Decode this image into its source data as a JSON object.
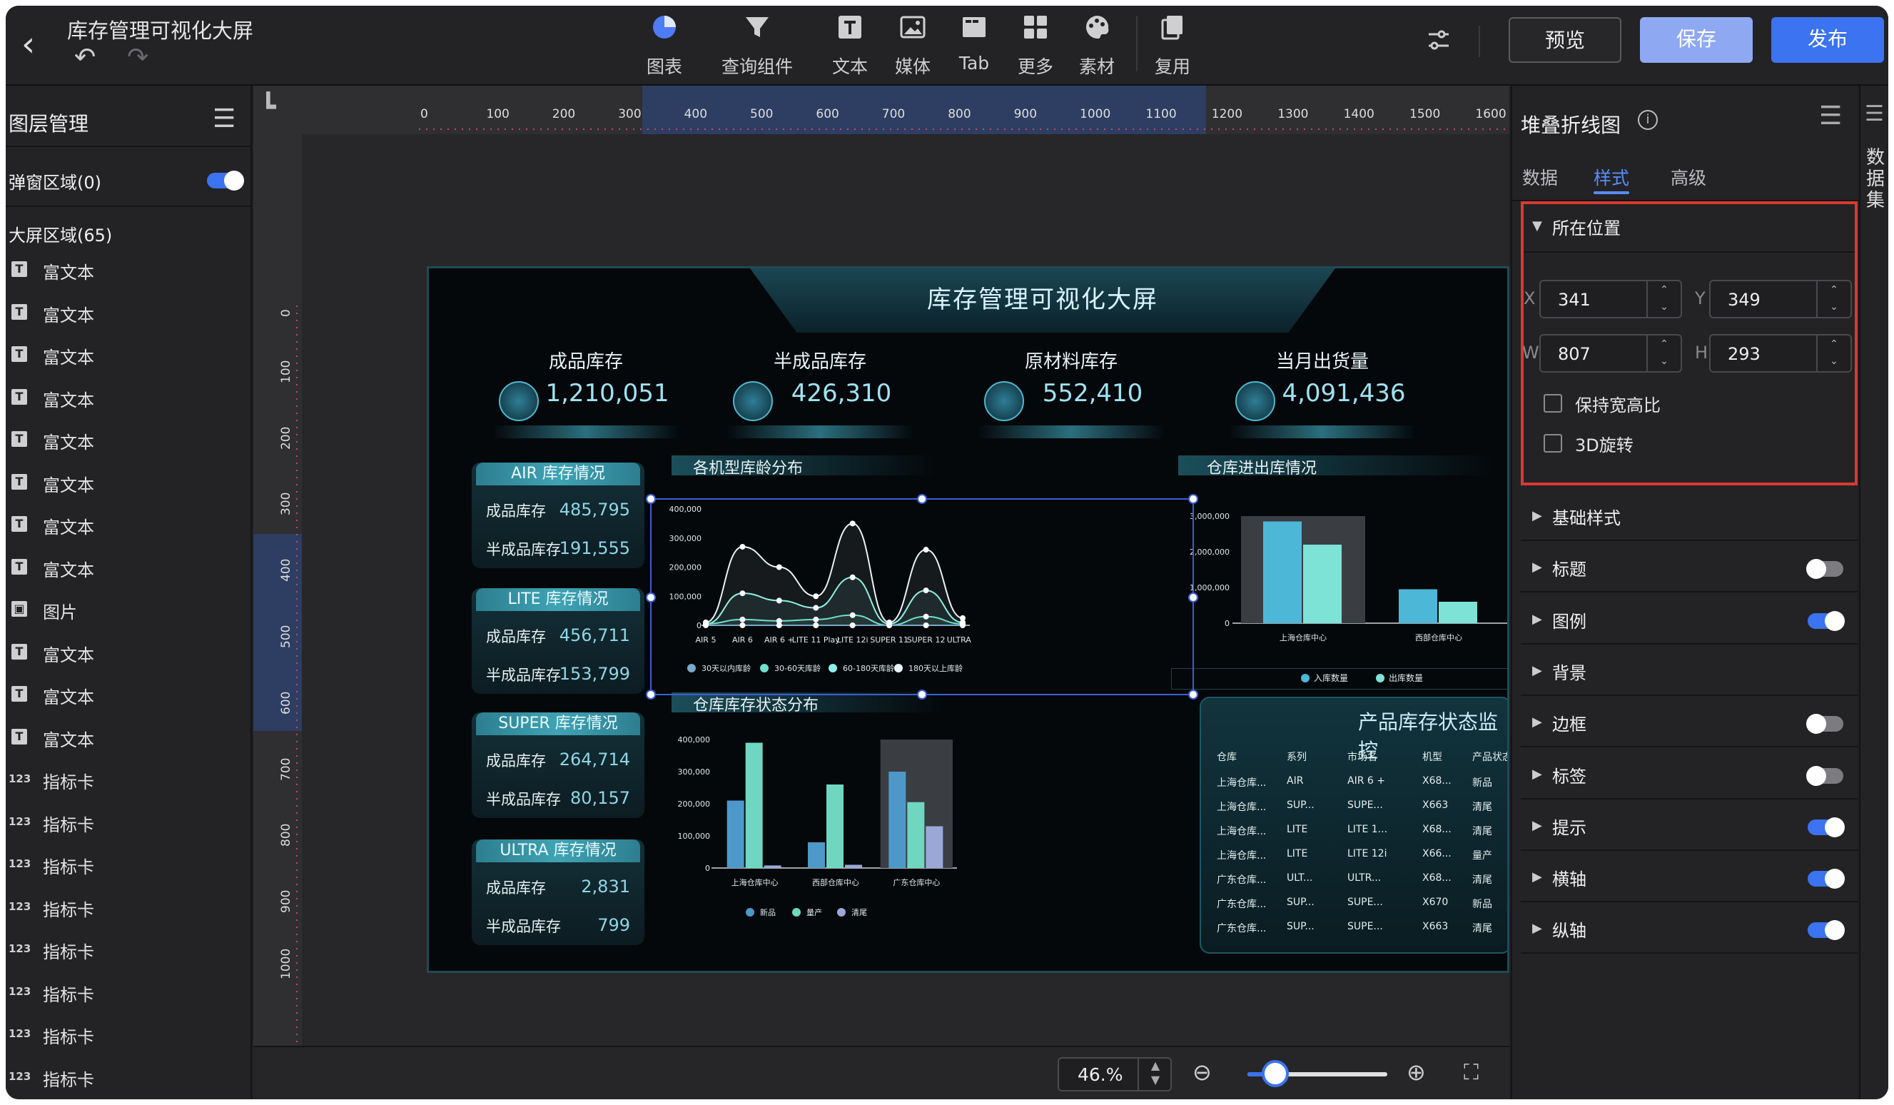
{
  "topbar": {
    "title": "库存管理可视化大屏",
    "tools": [
      {
        "label": "图表",
        "icon": "pie-chart-icon"
      },
      {
        "label": "查询组件",
        "icon": "filter-funnel-icon"
      },
      {
        "label": "文本",
        "icon": "text-icon"
      },
      {
        "label": "媒体",
        "icon": "image-icon"
      },
      {
        "label": "Tab",
        "icon": "tab-icon"
      },
      {
        "label": "更多",
        "icon": "grid-icon"
      },
      {
        "label": "素材",
        "icon": "palette-icon"
      },
      {
        "label": "复用",
        "icon": "copy-icon"
      }
    ],
    "preview": "预览",
    "save": "保存",
    "publish": "发布"
  },
  "left_panel": {
    "title": "图层管理",
    "popup_area": "弹窗区域(0)",
    "screen_area": "大屏区域(65)",
    "layers": [
      {
        "type": "text",
        "label": "富文本"
      },
      {
        "type": "text",
        "label": "富文本"
      },
      {
        "type": "text",
        "label": "富文本"
      },
      {
        "type": "text",
        "label": "富文本"
      },
      {
        "type": "text",
        "label": "富文本"
      },
      {
        "type": "text",
        "label": "富文本"
      },
      {
        "type": "text",
        "label": "富文本"
      },
      {
        "type": "text",
        "label": "富文本"
      },
      {
        "type": "image",
        "label": "图片"
      },
      {
        "type": "text",
        "label": "富文本"
      },
      {
        "type": "text",
        "label": "富文本"
      },
      {
        "type": "text",
        "label": "富文本"
      },
      {
        "type": "num",
        "label": "指标卡"
      },
      {
        "type": "num",
        "label": "指标卡"
      },
      {
        "type": "num",
        "label": "指标卡"
      },
      {
        "type": "num",
        "label": "指标卡"
      },
      {
        "type": "num",
        "label": "指标卡"
      },
      {
        "type": "num",
        "label": "指标卡"
      },
      {
        "type": "num",
        "label": "指标卡"
      },
      {
        "type": "num",
        "label": "指标卡"
      }
    ],
    "num_icon": "123",
    "text_icon": "T"
  },
  "ruler": {
    "h_ticks": [
      "0",
      "100",
      "200",
      "300",
      "400",
      "500",
      "600",
      "700",
      "800",
      "900",
      "1000",
      "1100",
      "1200",
      "1300",
      "1400",
      "1500",
      "1600"
    ],
    "v_ticks": [
      "0",
      "100",
      "200",
      "300",
      "400",
      "500",
      "600",
      "700",
      "800",
      "900",
      "1000"
    ]
  },
  "dashboard": {
    "title": "库存管理可视化大屏",
    "kpis": [
      {
        "label": "成品库存",
        "value": "1,210,051"
      },
      {
        "label": "半成品库存",
        "value": "426,310"
      },
      {
        "label": "原材料库存",
        "value": "552,410"
      },
      {
        "label": "当月出货量",
        "value": "4,091,436"
      }
    ],
    "cards": [
      {
        "title": "AIR 库存情况",
        "l1": "成品库存",
        "v1": "485,795",
        "l2": "半成品库存",
        "v2": "191,555"
      },
      {
        "title": "LITE 库存情况",
        "l1": "成品库存",
        "v1": "456,711",
        "l2": "半成品库存",
        "v2": "153,799"
      },
      {
        "title": "SUPER 库存情况",
        "l1": "成品库存",
        "v1": "264,714",
        "l2": "半成品库存",
        "v2": "80,157"
      },
      {
        "title": "ULTRA 库存情况",
        "l1": "成品库存",
        "v1": "2,831",
        "l2": "半成品库存",
        "v2": "799"
      }
    ],
    "section_age": "各机型库龄分布",
    "section_status": "仓库库存状态分布",
    "section_io": "仓库进出库情况",
    "table_title": "产品库存状态监控",
    "table_headers": [
      "仓库",
      "系列",
      "市场名",
      "机型",
      "产品状态"
    ],
    "table_rows": [
      [
        "上海仓库...",
        "AIR",
        "AIR 6 +",
        "X68...",
        "新品"
      ],
      [
        "上海仓库...",
        "SUP...",
        "SUPE...",
        "X663",
        "清尾"
      ],
      [
        "上海仓库...",
        "LITE",
        "LITE 1...",
        "X68...",
        "清尾"
      ],
      [
        "上海仓库...",
        "LITE",
        "LITE 12i",
        "X66...",
        "量产"
      ],
      [
        "广东仓库...",
        "ULT...",
        "ULTR...",
        "X68...",
        "清尾"
      ],
      [
        "广东仓库...",
        "SUP...",
        "SUPE...",
        "X670",
        "新品"
      ],
      [
        "广东仓库...",
        "SUP...",
        "SUPE...",
        "X663",
        "清尾"
      ]
    ]
  },
  "chart_data": [
    {
      "type": "line",
      "categories": [
        "AIR 5",
        "AIR 6",
        "AIR 6 +",
        "LITE 11 Play",
        "LITE 12i",
        "SUPER 11",
        "SUPER 12",
        "ULTRA 3"
      ],
      "ylim": [
        0,
        400000
      ],
      "yticks": [
        "0",
        "100,000",
        "200,000",
        "300,000",
        "400,000"
      ],
      "series": [
        {
          "name": "30天以内库龄",
          "color": "#7aa9c9",
          "values": [
            0,
            0,
            0,
            0,
            0,
            0,
            0,
            0
          ]
        },
        {
          "name": "30-60天库龄",
          "color": "#6fe0cf",
          "values": [
            5000,
            20000,
            15000,
            20000,
            35000,
            0,
            30000,
            5000
          ]
        },
        {
          "name": "60-180天库龄",
          "color": "#8ff0e6",
          "values": [
            5000,
            110000,
            85000,
            60000,
            165000,
            5000,
            120000,
            10000
          ]
        },
        {
          "name": "180天以上库龄",
          "color": "#e8f4f6",
          "values": [
            10000,
            270000,
            200000,
            100000,
            350000,
            10000,
            260000,
            25000
          ]
        }
      ]
    },
    {
      "type": "bar",
      "categories": [
        "上海仓库中心",
        "西部仓库中心",
        "广东仓库中心"
      ],
      "ylim": [
        0,
        400000
      ],
      "yticks": [
        "0",
        "100,000",
        "200,000",
        "300,000",
        "400,000"
      ],
      "series": [
        {
          "name": "新品",
          "color": "#4d98c8",
          "values": [
            210000,
            80000,
            300000
          ]
        },
        {
          "name": "量产",
          "color": "#6fd7c0",
          "values": [
            390000,
            260000,
            205000
          ]
        },
        {
          "name": "清尾",
          "color": "#9aa8d8",
          "values": [
            8000,
            10000,
            130000
          ]
        }
      ]
    },
    {
      "type": "bar",
      "categories": [
        "上海仓库中心",
        "西部仓库中心"
      ],
      "ylim": [
        0,
        3000000
      ],
      "yticks": [
        "0",
        "1,000,000",
        "2,000,000",
        "3,000,000"
      ],
      "series": [
        {
          "name": "入库数量",
          "color": "#4db7d8",
          "values": [
            2850000,
            950000
          ]
        },
        {
          "name": "出库数量",
          "color": "#7de3d6",
          "values": [
            2200000,
            600000
          ]
        }
      ]
    }
  ],
  "zoom": {
    "value": "46.%",
    "fill_fraction": 0.2
  },
  "right_panel": {
    "title": "堆叠折线图",
    "tabs": [
      "数据",
      "样式",
      "高级"
    ],
    "position_section": "所在位置",
    "x_label": "X",
    "x_value": "341",
    "y_label": "Y",
    "y_value": "349",
    "w_label": "W",
    "w_value": "807",
    "h_label": "H",
    "h_value": "293",
    "keep_ratio": "保持宽高比",
    "rotate_3d": "3D旋转",
    "sections": [
      {
        "label": "基础样式",
        "toggle": null
      },
      {
        "label": "标题",
        "toggle": false
      },
      {
        "label": "图例",
        "toggle": true
      },
      {
        "label": "背景",
        "toggle": null
      },
      {
        "label": "边框",
        "toggle": false
      },
      {
        "label": "标签",
        "toggle": false
      },
      {
        "label": "提示",
        "toggle": true
      },
      {
        "label": "横轴",
        "toggle": true
      },
      {
        "label": "纵轴",
        "toggle": true
      }
    ]
  },
  "far_right": {
    "label": "数据集"
  }
}
